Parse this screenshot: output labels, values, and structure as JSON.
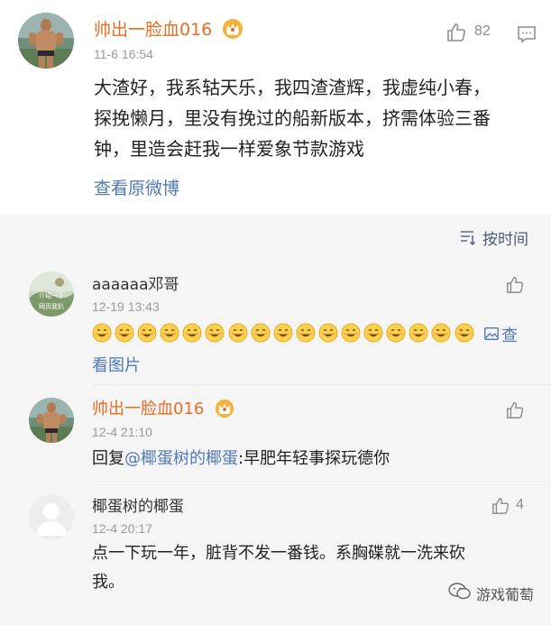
{
  "main_post": {
    "author": "帅出一脸血016",
    "time": "11-6 16:54",
    "like_count": "82",
    "text_lines": [
      "大渣好，我系轱天乐，我四渣渣辉，我虚纯小春，",
      "探挽懒月，里没有挽过的船新版本，挤需体验三番",
      "钟，里造会赶我一样爱象节款游戏"
    ],
    "view_original": "查看原微博",
    "sort_label": "按时间"
  },
  "comments": [
    {
      "author": "aaaaaa邓哥",
      "time": "12-19 13:43",
      "avatar_text": "介绍一下 网页我扒",
      "emoji_count": 17,
      "view_image_part1": "查",
      "view_image_part2": "看图片"
    },
    {
      "author": "帅出一脸血016",
      "time": "12-4 21:10",
      "reply_prefix": "回复",
      "mention": "@椰蛋树的椰蛋",
      "reply_text": ":早肥年轻事探玩德你"
    },
    {
      "author": "椰蛋树的椰蛋",
      "time": "12-4 20:17",
      "like_count": "4",
      "text_lines": [
        "点一下玩一年，脏背不发一番钱。系胸碟就一洗来砍",
        "我。"
      ]
    }
  ],
  "watermark": {
    "text": "游戏葡萄"
  },
  "colors": {
    "author_orange": "#e86d21",
    "link_blue": "#4f79b8",
    "section_bg": "#f5f5f5"
  }
}
